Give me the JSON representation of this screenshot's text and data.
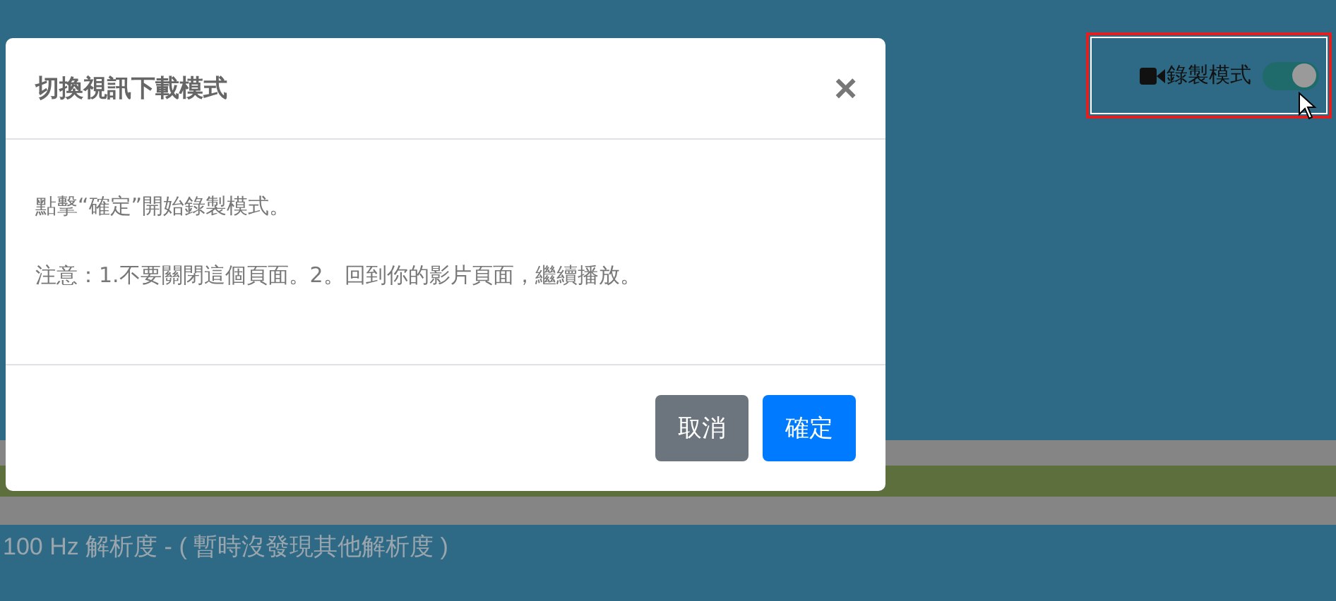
{
  "record_mode": {
    "label": "錄製模式",
    "on": true
  },
  "resolution_note": "100 Hz 解析度 - ( 暫時沒發現其他解析度 )",
  "modal": {
    "title": "切換視訊下載模式",
    "close": "×",
    "paragraphs": [
      "點擊“確定”開始錄製模式。",
      "注意：1.不要關閉這個頁面。2。回到你的影片頁面，繼續播放。"
    ],
    "buttons": [
      {
        "label": "取消",
        "kind": "secondary"
      },
      {
        "label": "確定",
        "kind": "primary"
      }
    ]
  }
}
